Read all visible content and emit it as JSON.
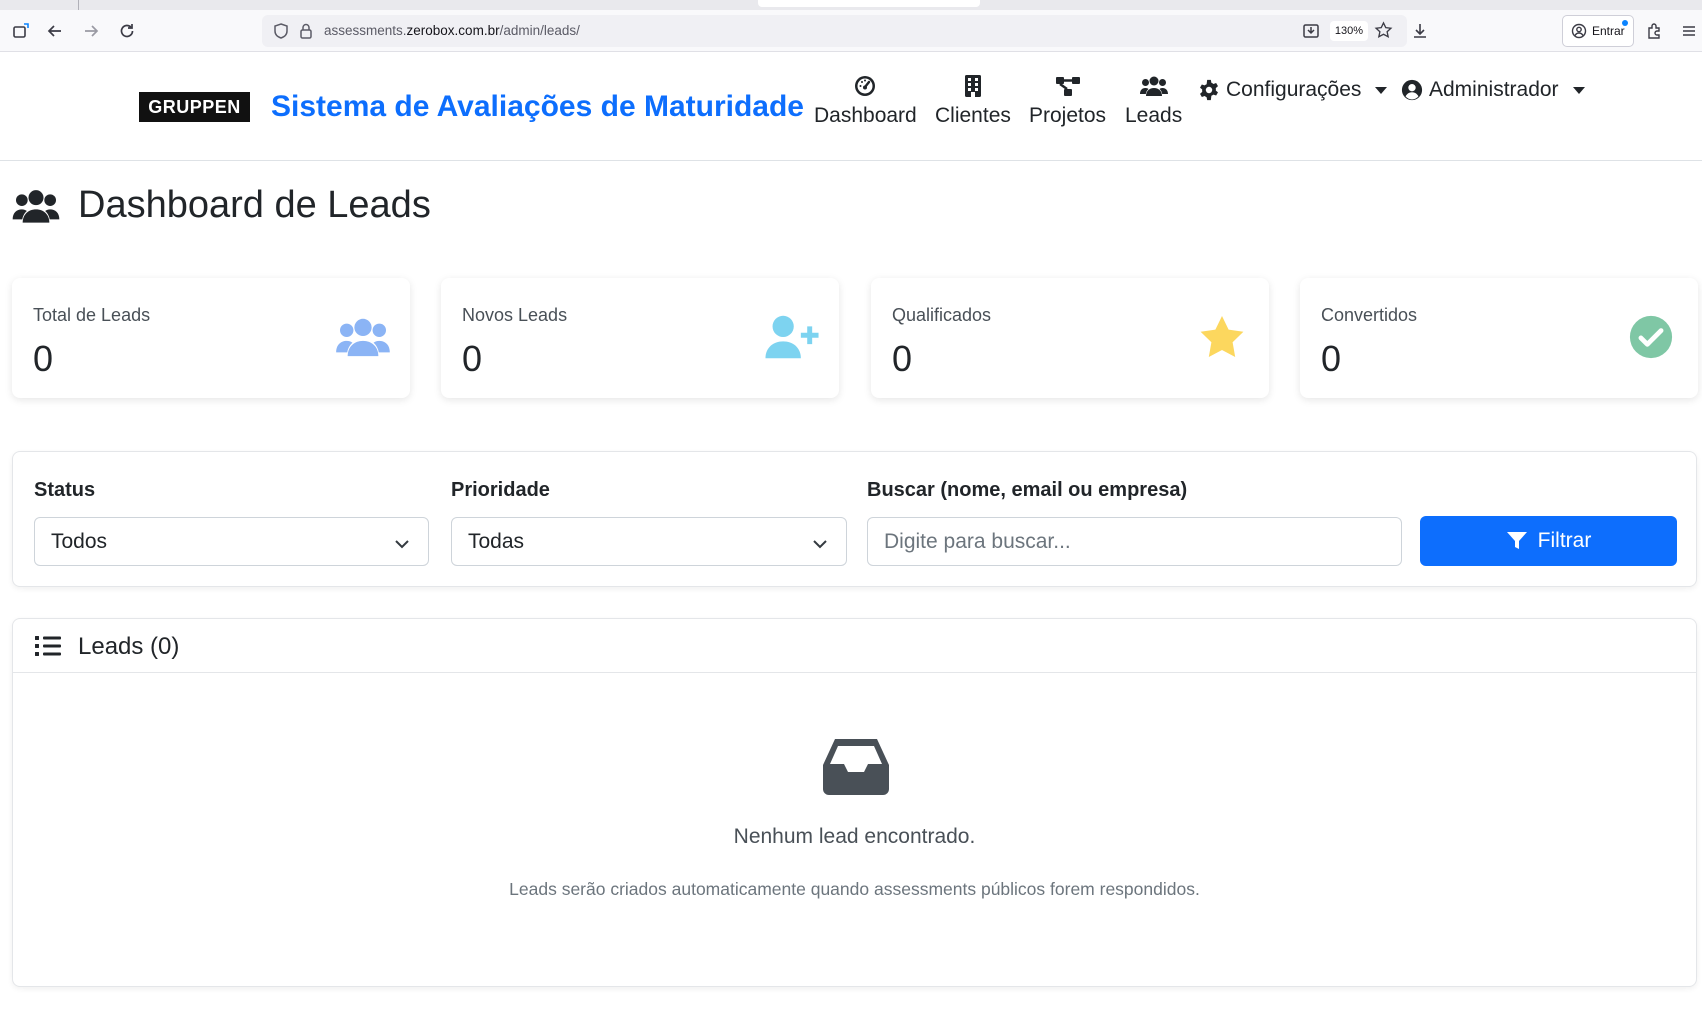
{
  "browser": {
    "url_prefix": "assessments.",
    "url_host": "zerobox.com.br",
    "url_path": "/admin/leads/",
    "zoom": "130%",
    "signin_label": "Entrar"
  },
  "navbar": {
    "logo_text": "GRUPPEN",
    "title": "Sistema de Avaliações de Maturidade",
    "items": [
      {
        "label": "Dashboard",
        "icon": "gauge-icon"
      },
      {
        "label": "Clientes",
        "icon": "building-icon"
      },
      {
        "label": "Projetos",
        "icon": "project-diagram-icon"
      },
      {
        "label": "Leads",
        "icon": "users-icon"
      }
    ],
    "settings_label": "Configurações",
    "user_label": "Administrador"
  },
  "page": {
    "title": "Dashboard de Leads"
  },
  "stats": [
    {
      "label": "Total de Leads",
      "value": "0",
      "icon": "users-icon",
      "color": "#8bb4f5"
    },
    {
      "label": "Novos Leads",
      "value": "0",
      "icon": "user-plus-icon",
      "color": "#7dd3f0"
    },
    {
      "label": "Qualificados",
      "value": "0",
      "icon": "star-icon",
      "color": "#fcd75e"
    },
    {
      "label": "Convertidos",
      "value": "0",
      "icon": "check-circle-icon",
      "color": "#7fc7a5"
    }
  ],
  "filters": {
    "status_label": "Status",
    "status_value": "Todos",
    "priority_label": "Prioridade",
    "priority_value": "Todas",
    "search_label": "Buscar (nome, email ou empresa)",
    "search_placeholder": "Digite para buscar...",
    "button_label": "Filtrar"
  },
  "leads": {
    "title": "Leads (0)",
    "empty_title": "Nenhum lead encontrado.",
    "empty_subtitle": "Leads serão criados automaticamente quando assessments públicos forem respondidos."
  },
  "colors": {
    "primary": "#0d6efd",
    "brand_logo_bg": "#111111"
  }
}
